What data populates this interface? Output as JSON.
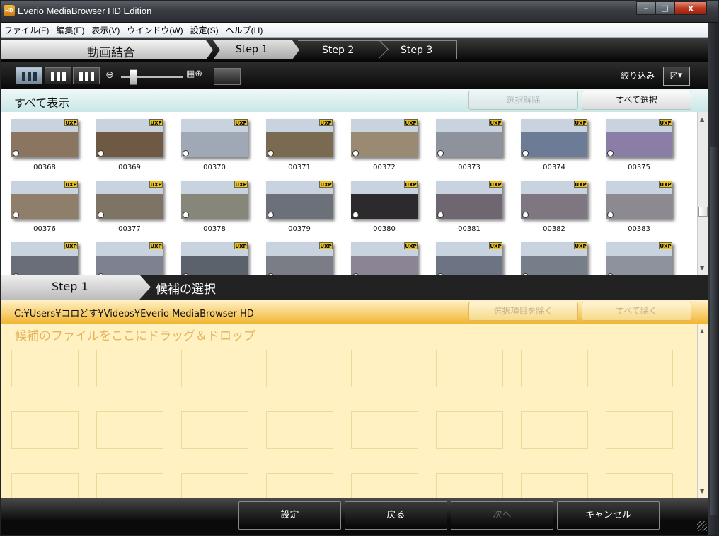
{
  "window": {
    "title": "Everio MediaBrowser HD Edition",
    "app_icon": "HD",
    "controls": {
      "minimize": "–",
      "maximize": "□",
      "close": "x"
    }
  },
  "menu": [
    "ファイル(F)",
    "編集(E)",
    "表示(V)",
    "ウインドウ(W)",
    "設定(S)",
    "ヘルプ(H)"
  ],
  "wizard": {
    "title": "動画結合",
    "steps": [
      "Step 1",
      "Step 2",
      "Step 3"
    ]
  },
  "toolbar": {
    "filter_label": "絞り込み",
    "filter_icon": "◸▾"
  },
  "library": {
    "show_all_label": "すべて表示",
    "deselect_label": "選択解除",
    "select_all_label": "すべて選択",
    "badge": "UXP",
    "clips": [
      {
        "label": "00368",
        "color": "#8a7560"
      },
      {
        "label": "00369",
        "color": "#6e5a44"
      },
      {
        "label": "00370",
        "color": "#a0a8b6"
      },
      {
        "label": "00371",
        "color": "#7a6a52"
      },
      {
        "label": "00372",
        "color": "#9a8a74"
      },
      {
        "label": "00373",
        "color": "#8e929c"
      },
      {
        "label": "00374",
        "color": "#6d7c96"
      },
      {
        "label": "00375",
        "color": "#8a7ea6"
      },
      {
        "label": "00376",
        "color": "#8f7e6a"
      },
      {
        "label": "00377",
        "color": "#7e7466"
      },
      {
        "label": "00378",
        "color": "#86877a"
      },
      {
        "label": "00379",
        "color": "#6c7078"
      },
      {
        "label": "00380",
        "color": "#2c2a2c"
      },
      {
        "label": "00381",
        "color": "#6e6670"
      },
      {
        "label": "00382",
        "color": "#7e7680"
      },
      {
        "label": "00383",
        "color": "#8c8a90"
      },
      {
        "label": "",
        "color": "#6a6e78"
      },
      {
        "label": "",
        "color": "#7e8290"
      },
      {
        "label": "",
        "color": "#5c626c"
      },
      {
        "label": "",
        "color": "#7a7c86"
      },
      {
        "label": "",
        "color": "#8a8494"
      },
      {
        "label": "",
        "color": "#6c7484"
      },
      {
        "label": "",
        "color": "#767e8a"
      },
      {
        "label": "",
        "color": "#8e929c"
      }
    ]
  },
  "candidates": {
    "step_label": "Step 1",
    "title": "候補の選択",
    "path": "C:¥Users¥コロどす¥Videos¥Everio MediaBrowser HD",
    "remove_selected_label": "選択項目を除く",
    "remove_all_label": "すべて除く",
    "drop_hint": "候補のファイルをここにドラッグ＆ドロップ"
  },
  "footer": {
    "settings": "設定",
    "back": "戻る",
    "next": "次へ",
    "cancel": "キャンセル"
  }
}
